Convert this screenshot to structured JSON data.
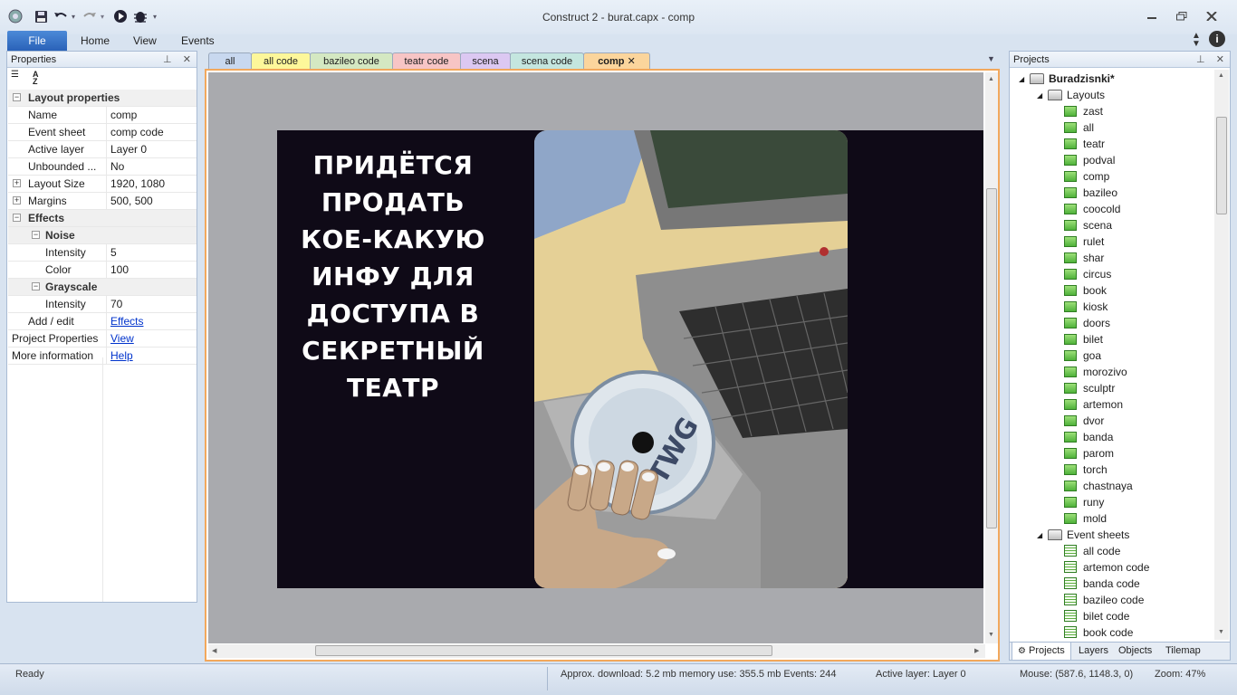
{
  "window": {
    "title": "Construct 2 - burat.capx - comp"
  },
  "ribbon": {
    "file": "File",
    "tabs": [
      "Home",
      "View",
      "Events"
    ]
  },
  "properties": {
    "title": "Properties",
    "rows": [
      {
        "key": "Layout properties",
        "value": "",
        "kind": "cat"
      },
      {
        "key": "Name",
        "value": "comp"
      },
      {
        "key": "Event sheet",
        "value": "comp code"
      },
      {
        "key": "Active layer",
        "value": "Layer 0"
      },
      {
        "key": "Unbounded ...",
        "value": "No"
      },
      {
        "key": "Layout Size",
        "value": "1920, 1080",
        "expand": true
      },
      {
        "key": "Margins",
        "value": "500, 500",
        "expand": true
      },
      {
        "key": "Effects",
        "value": "",
        "kind": "cat"
      },
      {
        "key": "Noise",
        "value": "",
        "kind": "sub"
      },
      {
        "key": "Intensity",
        "value": "5"
      },
      {
        "key": "Color",
        "value": "100"
      },
      {
        "key": "Grayscale",
        "value": "",
        "kind": "sub"
      },
      {
        "key": "Intensity",
        "value": "70"
      },
      {
        "key": "Add / edit",
        "value": "Effects",
        "link": true
      },
      {
        "key": "Project Properties",
        "value": "View",
        "link": true
      },
      {
        "key": "More information",
        "value": "Help",
        "link": true
      }
    ]
  },
  "doc_tabs": [
    {
      "label": "all",
      "color": "#c8d8ef"
    },
    {
      "label": "all code",
      "color": "#fdf79a"
    },
    {
      "label": "bazileo code",
      "color": "#d4e8c2"
    },
    {
      "label": "teatr code",
      "color": "#f7c5c5"
    },
    {
      "label": "scena",
      "color": "#dcc8f2"
    },
    {
      "label": "scena code",
      "color": "#c4e6df"
    },
    {
      "label": "comp",
      "color": "#fbd59c",
      "active": true
    }
  ],
  "canvas": {
    "text": "ПРИДЁТСЯ ПРОДАТЬ КОЕ-КАКУЮ ИНФУ ДЛЯ ДОСТУПА В СЕКРЕТНЫЙ ТЕАТР",
    "text_lines": [
      "ПРИДЁТСЯ",
      "ПРОДАТЬ",
      "КОЕ-КАКУЮ",
      "ИНФУ ДЛЯ",
      "ДОСТУПА В",
      "СЕКРЕТНЫЙ",
      "ТЕАТР"
    ],
    "disc_label": "TWG"
  },
  "projects": {
    "title": "Projects",
    "root": "Buradzisnki*",
    "layouts_folder": "Layouts",
    "layouts": [
      "zast",
      "all",
      "teatr",
      "podval",
      "comp",
      "bazileo",
      "coocold",
      "scena",
      "rulet",
      "shar",
      "circus",
      "book",
      "kiosk",
      "doors",
      "bilet",
      "goa",
      "morozivo",
      "sculptr",
      "artemon",
      "dvor",
      "banda",
      "parom",
      "torch",
      "chastnaya",
      "runy",
      "mold"
    ],
    "events_folder": "Event sheets",
    "event_sheets": [
      "all code",
      "artemon code",
      "banda code",
      "bazileo code",
      "bilet code",
      "book code"
    ],
    "bottom_tabs": [
      "Projects",
      "Layers",
      "Objects",
      "Tilemap"
    ]
  },
  "status": {
    "ready": "Ready",
    "download": "Approx. download: 5.2 mb  memory use: 355.5 mb  Events: 244",
    "active_layer": "Active layer: Layer 0",
    "mouse": "Mouse: (587.6, 1148.3, 0)",
    "zoom": "Zoom: 47%"
  },
  "colors": {
    "accent": "#2a62b8",
    "active_tab": "#fbd59c",
    "canvas_bg": "#0f0a17"
  }
}
